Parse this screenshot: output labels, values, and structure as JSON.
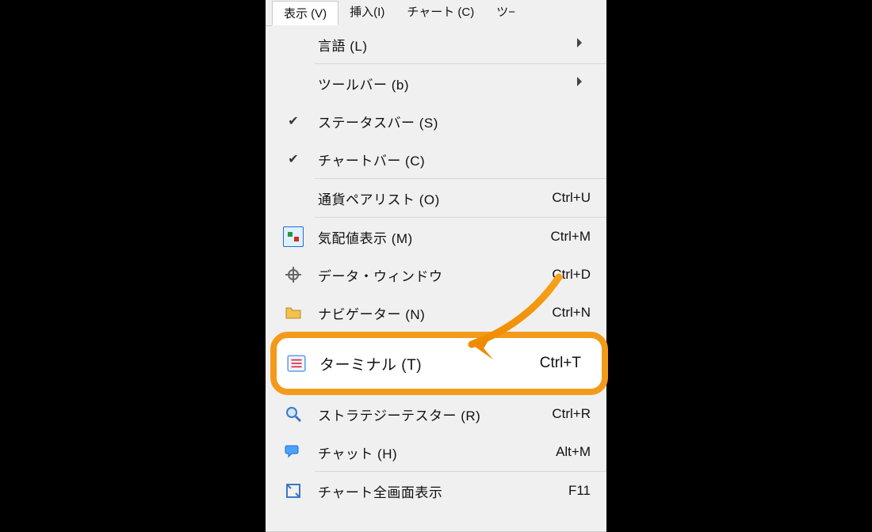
{
  "menubar": {
    "view": "表示 (V)",
    "insert": "挿入(I)",
    "chart": "チャート (C)",
    "tool": "ツ−"
  },
  "menu": {
    "language": {
      "label": "言語 (L)"
    },
    "toolbar": {
      "label": "ツールバー (b)"
    },
    "statusbar": {
      "label": "ステータスバー (S)"
    },
    "chartbar": {
      "label": "チャートバー (C)"
    },
    "pairlist": {
      "label": "通貨ペアリスト (O)",
      "shortcut": "Ctrl+U"
    },
    "quotes": {
      "label": "気配値表示 (M)",
      "shortcut": "Ctrl+M"
    },
    "datawindow": {
      "label": "データ・ウィンドウ",
      "shortcut": "Ctrl+D"
    },
    "navigator": {
      "label": "ナビゲーター (N)",
      "shortcut": "Ctrl+N"
    },
    "terminal": {
      "label": "ターミナル (T)",
      "shortcut": "Ctrl+T"
    },
    "strategytest": {
      "label": "ストラテジーテスター (R)",
      "shortcut": "Ctrl+R"
    },
    "chat": {
      "label": "チャット (H)",
      "shortcut": "Alt+M"
    },
    "fullscreen": {
      "label": "チャート全画面表示",
      "shortcut": "F11"
    }
  },
  "icons": {
    "quotes": "quotes-icon",
    "datawindow": "crosshair-icon",
    "navigator": "folder-icon",
    "terminal": "terminal-icon",
    "strategy": "magnifier-icon",
    "chat": "chat-icon",
    "fullscreen": "fullscreen-icon"
  }
}
